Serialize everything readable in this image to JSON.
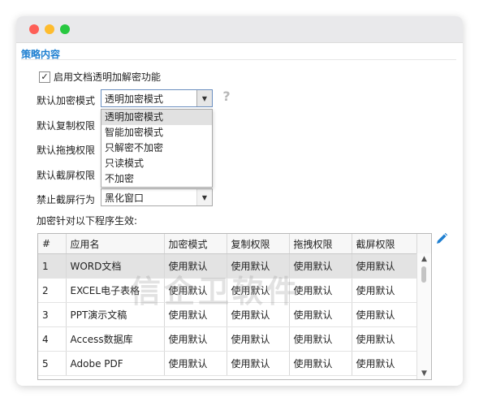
{
  "section_title": "策略内容",
  "enable_checkbox": {
    "checked": true,
    "label": "启用文档透明加解密功能"
  },
  "fields": {
    "encrypt_mode": {
      "label": "默认加密模式",
      "value": "透明加密模式"
    },
    "copy_permission": {
      "label": "默认复制权限"
    },
    "drag_permission": {
      "label": "默认拖拽权限"
    },
    "screenshot_permission": {
      "label": "默认截屏权限"
    },
    "block_screenshot": {
      "label": "禁止截屏行为",
      "value": "黑化窗口"
    }
  },
  "help_icon": "?",
  "encrypt_mode_options": [
    {
      "label": "透明加密模式",
      "selected": true
    },
    {
      "label": "智能加密模式",
      "selected": false
    },
    {
      "label": "只解密不加密",
      "selected": false
    },
    {
      "label": "只读模式",
      "selected": false
    },
    {
      "label": "不加密",
      "selected": false
    }
  ],
  "table_title": "加密针对以下程序生效:",
  "table": {
    "columns": [
      "#",
      "应用名",
      "加密模式",
      "复制权限",
      "拖拽权限",
      "截屏权限"
    ],
    "rows": [
      [
        "1",
        "WORD文档",
        "使用默认",
        "使用默认",
        "使用默认",
        "使用默认"
      ],
      [
        "2",
        "EXCEL电子表格",
        "使用默认",
        "使用默认",
        "使用默认",
        "使用默认"
      ],
      [
        "3",
        "PPT演示文稿",
        "使用默认",
        "使用默认",
        "使用默认",
        "使用默认"
      ],
      [
        "4",
        "Access数据库",
        "使用默认",
        "使用默认",
        "使用默认",
        "使用默认"
      ],
      [
        "5",
        "Adobe PDF",
        "使用默认",
        "使用默认",
        "使用默认",
        "使用默认"
      ]
    ],
    "selected_row": 0
  },
  "watermark": "信企卫软件",
  "colors": {
    "accent": "#1e7fd1",
    "selected_row": "#e3e3e3"
  }
}
